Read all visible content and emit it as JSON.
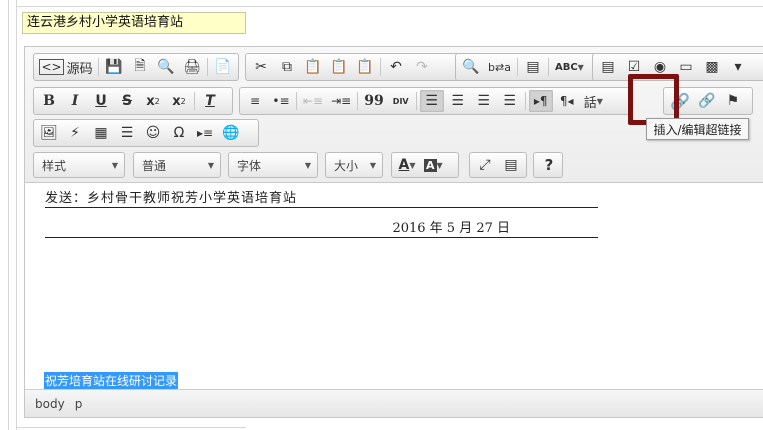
{
  "form": {
    "title_value": "连云港乡村小学英语培育站"
  },
  "toolbar": {
    "row1": {
      "source_label": "源码",
      "spellcheck_label": "ABC"
    },
    "row2": {
      "bold": "B",
      "italic": "I",
      "underline": "U",
      "strike": "S",
      "subscript": "x",
      "superscript": "x",
      "sub_mark": "2",
      "sup_mark": "2",
      "remove_format": "T",
      "blockquote": "99",
      "creatediv": "DIV",
      "language": "話"
    },
    "row4": {
      "styles": "样式",
      "format": "普通",
      "font": "字体",
      "size": "大小",
      "text_color_letter": "A",
      "bg_color_letter": "A",
      "help": "?"
    }
  },
  "tooltip": {
    "text": "插入/编辑超链接"
  },
  "document": {
    "line1": "发送：乡村骨干教师祝芳小学英语培育站",
    "line2": "2016 年 5 月 27 日",
    "selected_text": "祝芳培育站在线研讨记录"
  },
  "status_bar": {
    "path": [
      "body",
      "p"
    ]
  }
}
